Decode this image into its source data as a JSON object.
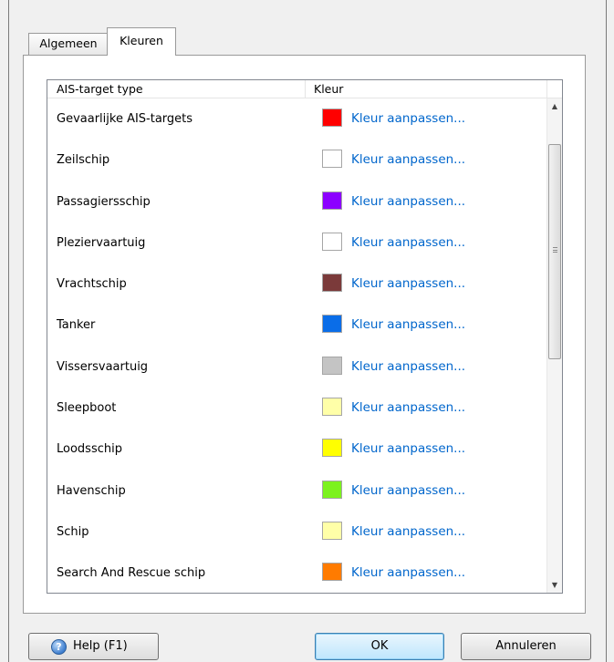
{
  "tabs": [
    {
      "label": "Algemeen",
      "active": false
    },
    {
      "label": "Kleuren",
      "active": true
    }
  ],
  "list": {
    "columns": {
      "type": "AIS-target type",
      "color": "Kleur"
    },
    "link_label": "Kleur aanpassen...",
    "rows": [
      {
        "type": "Gevaarlijke AIS-targets",
        "color": "#ff0000"
      },
      {
        "type": "Zeilschip",
        "color": "#ffffff"
      },
      {
        "type": "Passagiersschip",
        "color": "#8c00ff"
      },
      {
        "type": "Pleziervaartuig",
        "color": "#ffffff"
      },
      {
        "type": "Vrachtschip",
        "color": "#7b3a3a"
      },
      {
        "type": "Tanker",
        "color": "#0a6de8"
      },
      {
        "type": "Vissersvaartuig",
        "color": "#c4c4c4"
      },
      {
        "type": "Sleepboot",
        "color": "#ffffa8"
      },
      {
        "type": "Loodsschip",
        "color": "#ffff00"
      },
      {
        "type": "Havenschip",
        "color": "#7cf21e"
      },
      {
        "type": "Schip",
        "color": "#ffffa8"
      },
      {
        "type": "Search And Rescue schip",
        "color": "#ff7b00"
      },
      {
        "type": "",
        "color": "#ffffa8"
      }
    ]
  },
  "scrollbar": {
    "up_icon": "up-arrow-icon",
    "down_icon": "down-arrow-icon",
    "position": 0.1
  },
  "buttons": {
    "help": "Help (F1)",
    "help_icon": "?",
    "ok": "OK",
    "cancel": "Annuleren"
  }
}
